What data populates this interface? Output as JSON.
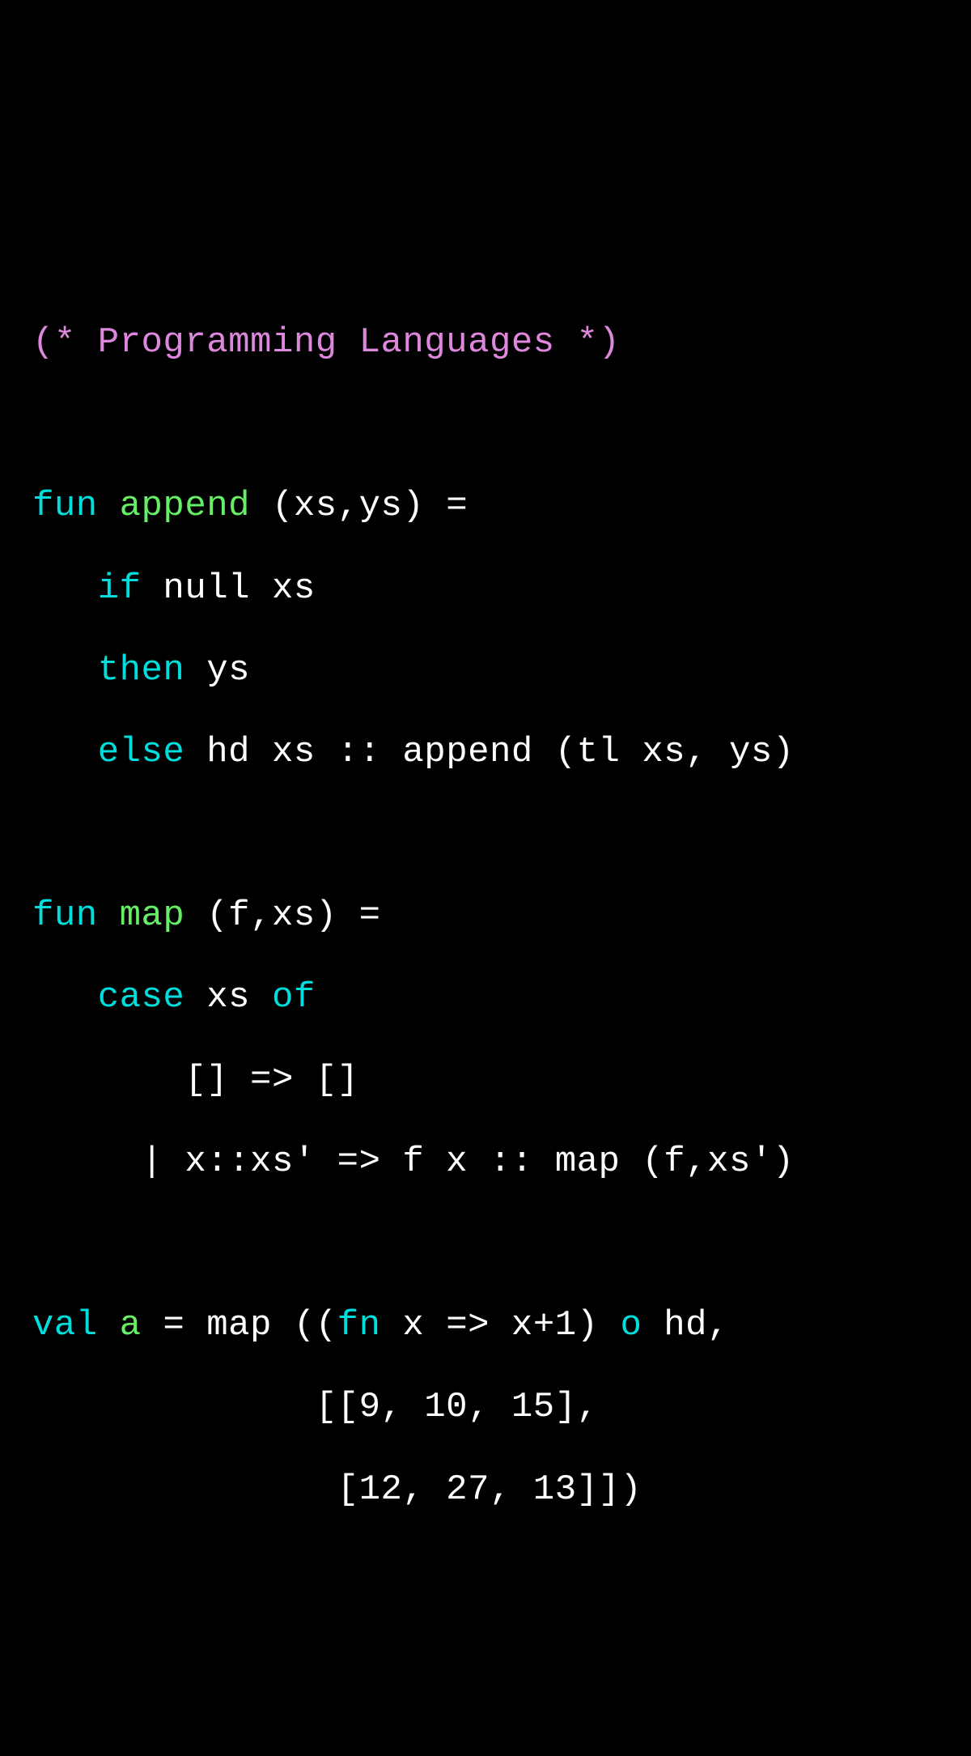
{
  "code": {
    "line1": {
      "comment": "(* Programming Languages *)"
    },
    "line3": {
      "kw_fun": "fun",
      "fname": "append",
      "rest": " (xs,ys) ="
    },
    "line4": {
      "indent": "   ",
      "kw_if": "if",
      "rest": " null xs"
    },
    "line5": {
      "indent": "   ",
      "kw_then": "then",
      "rest": " ys"
    },
    "line6": {
      "indent": "   ",
      "kw_else": "else",
      "rest": " hd xs :: append (tl xs, ys)"
    },
    "line8": {
      "kw_fun": "fun",
      "fname": "map",
      "rest": " (f,xs) ="
    },
    "line9": {
      "indent": "   ",
      "kw_case": "case",
      "mid": " xs ",
      "kw_of": "of"
    },
    "line10": {
      "text": "       [] => []"
    },
    "line11": {
      "text": "     | x::xs' => f x :: map (f,xs')"
    },
    "line13": {
      "kw_val": "val",
      "sp1": " ",
      "varname": "a",
      "mid1": " = map ((",
      "kw_fn": "fn",
      "mid2": " x => x+1) ",
      "kw_o": "o",
      "rest": " hd,"
    },
    "line14": {
      "text": "             [[9, 10, 15],"
    },
    "line15": {
      "text": "              [12, 27, 13]])"
    }
  }
}
